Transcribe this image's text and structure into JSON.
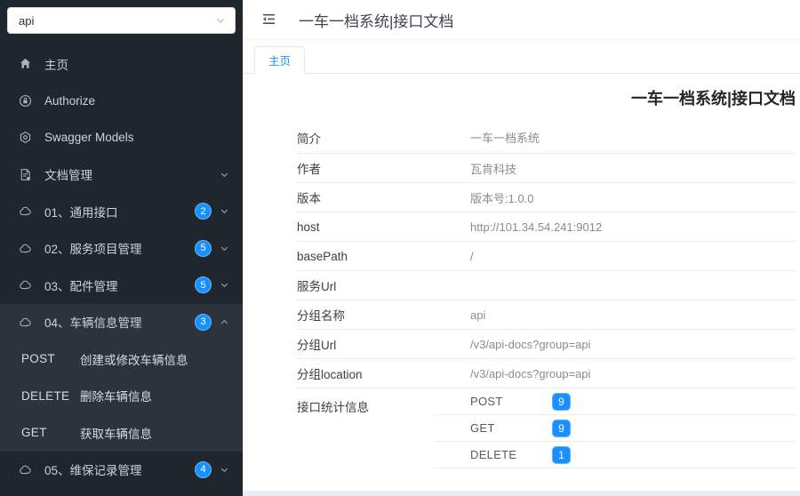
{
  "colors": {
    "accent": "#1890ff",
    "sidebar_bg": "#20262e",
    "badge_ring": "#6db5f2"
  },
  "sidebar": {
    "group_select": {
      "value": "api"
    },
    "items": [
      {
        "label": "主页"
      },
      {
        "label": "Authorize"
      },
      {
        "label": "Swagger Models"
      },
      {
        "label": "文档管理"
      },
      {
        "label": "01、通用接口",
        "badge": "2"
      },
      {
        "label": "02、服务项目管理",
        "badge": "5"
      },
      {
        "label": "03、配件管理",
        "badge": "5"
      },
      {
        "label": "04、车辆信息管理",
        "badge": "3"
      },
      {
        "label": "05、维保记录管理",
        "badge": "4"
      }
    ],
    "vehicle_submenu": [
      {
        "method": "POST",
        "label": "创建或修改车辆信息"
      },
      {
        "method": "DELETE",
        "label": "删除车辆信息"
      },
      {
        "method": "GET",
        "label": "获取车辆信息"
      }
    ]
  },
  "header": {
    "title": "一车一档系统|接口文档"
  },
  "tabs": [
    {
      "label": "主页"
    }
  ],
  "main": {
    "title": "一车一档系统|接口文档",
    "rows": [
      {
        "label": "简介",
        "value": "一车一档系统"
      },
      {
        "label": "作者",
        "value": "瓦肯科技"
      },
      {
        "label": "版本",
        "value": "版本号:1.0.0"
      },
      {
        "label": "host",
        "value": "http://101.34.54.241:9012"
      },
      {
        "label": "basePath",
        "value": "/"
      },
      {
        "label": "服务Url",
        "value": ""
      },
      {
        "label": "分组名称",
        "value": "api"
      },
      {
        "label": "分组Url",
        "value": "/v3/api-docs?group=api"
      },
      {
        "label": "分组location",
        "value": "/v3/api-docs?group=api"
      }
    ],
    "stats": {
      "label": "接口统计信息",
      "items": [
        {
          "method": "POST",
          "count": "9"
        },
        {
          "method": "GET",
          "count": "9"
        },
        {
          "method": "DELETE",
          "count": "1"
        }
      ]
    }
  }
}
